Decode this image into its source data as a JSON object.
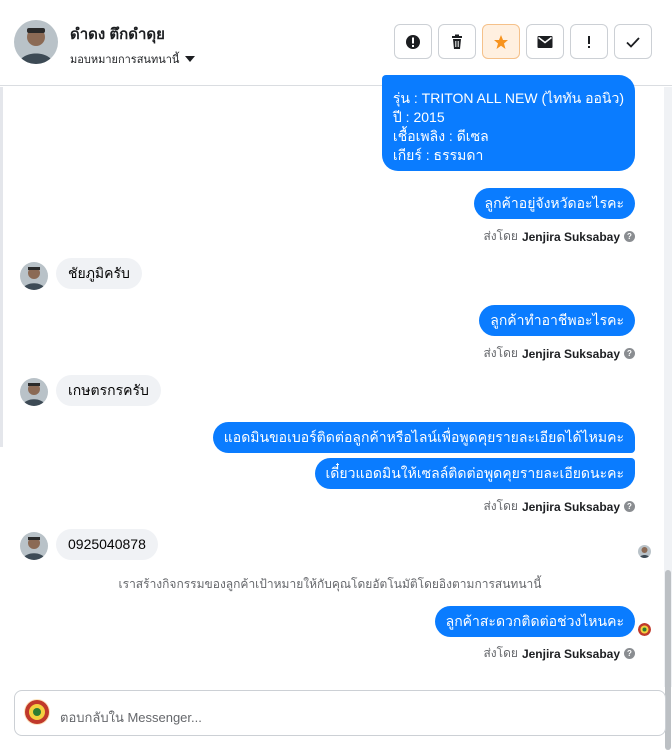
{
  "header": {
    "name": "ดำดง ตึกดำดุย",
    "assign_label": "มอบหมายการสนทนานี้",
    "actions": [
      "info-icon",
      "trash-icon",
      "star-icon",
      "mail-icon",
      "exclamation-icon",
      "check-icon"
    ],
    "accent": "#f7931e"
  },
  "messages": {
    "m1_lines": [
      "รุ่น : TRITON ALL NEW (ไททัน ออนิว)",
      "ปี : 2015",
      "เชื้อเพลิง : ดีเซล",
      "เกียร์ : ธรรมดา"
    ],
    "m2": "ลูกค้าอยู่จังหวัดอะไรคะ",
    "sent_prefix": "ส่งโดย",
    "sender": "Jenjira Suksabay",
    "r1": "ชัยภูมิครับ",
    "m3": "ลูกค้าทำอาชีพอะไรคะ",
    "r2": "เกษตรกรครับ",
    "m4": "แอดมินขอเบอร์ติดต่อลูกค้าหรือไลน์เพื่อพูดคุยรายละเอียดได้ไหมคะ",
    "m5": "เดี๋ยวแอดมินให้เซลล์ติดต่อพูดคุยรายละเอียดนะคะ",
    "r3": "0925040878",
    "system_note": "เราสร้างกิจกรรมของลูกค้าเป้าหมายให้กับคุณโดยอัตโนมัติโดยอิงตามการสนทนานี้",
    "m6": "ลูกค้าสะดวกติดต่อช่วงไหนคะ"
  },
  "composer": {
    "placeholder": "ตอบกลับใน Messenger..."
  },
  "colors": {
    "bubble_out": "#0a7cff",
    "bubble_in": "#f0f2f5"
  }
}
